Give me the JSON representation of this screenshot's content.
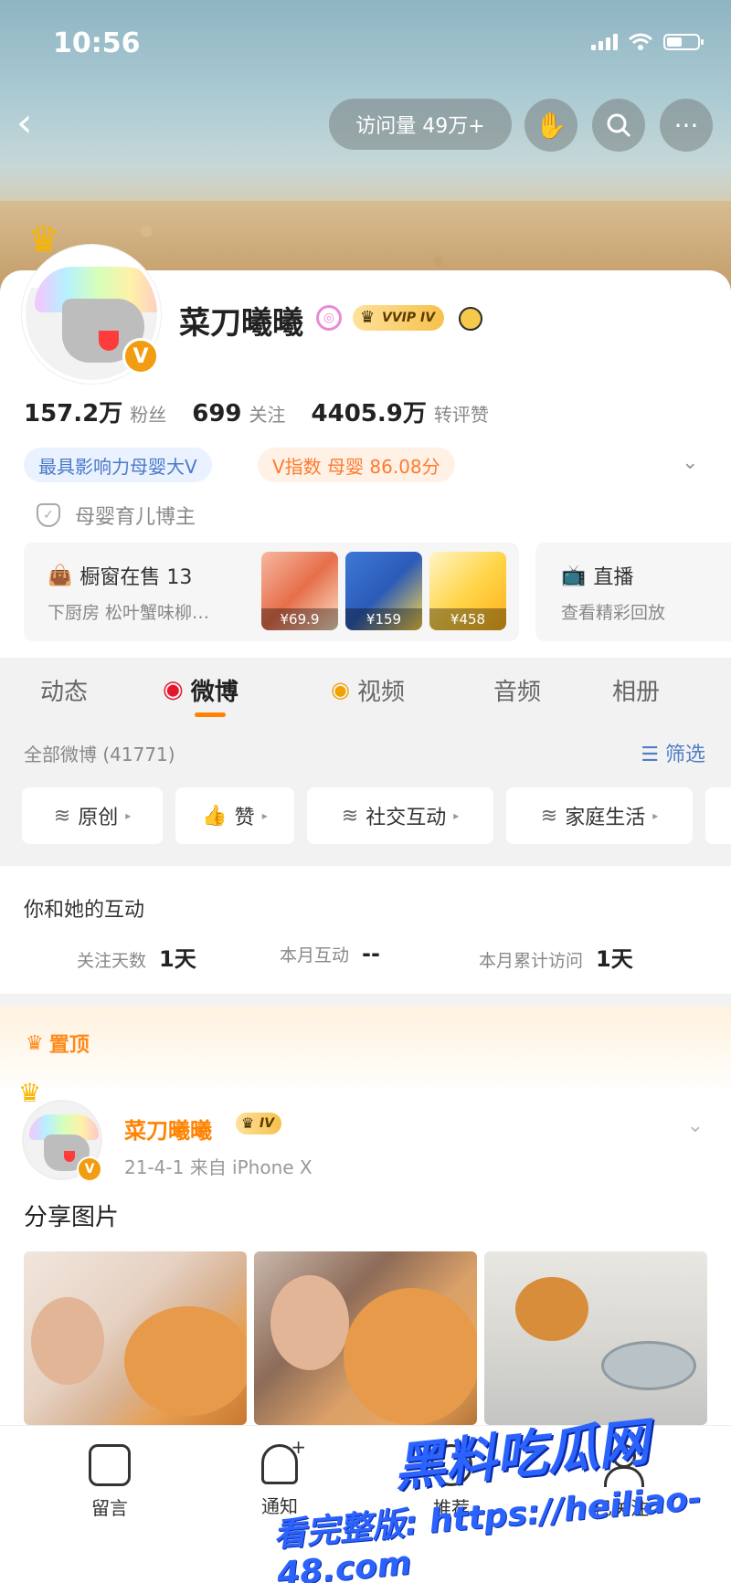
{
  "status_bar": {
    "time": "10:56"
  },
  "header": {
    "back_icon": "chevron-left-icon",
    "visits_label": "访问量 49万+",
    "icons": [
      "hand-icon",
      "search-icon",
      "more-icon"
    ]
  },
  "profile": {
    "name": "菜刀曦曦",
    "vvip_label": "VVIP IV",
    "v_badge": "V",
    "stats": [
      {
        "num": "157.2万",
        "label": "粉丝"
      },
      {
        "num": "699",
        "label": "关注"
      },
      {
        "num": "4405.9万",
        "label": "转评赞"
      }
    ],
    "tags": {
      "influence": "最具影响力母婴大V",
      "v_index": "V指数 母婴 86.08分"
    },
    "certification": "母婴育儿博主"
  },
  "shop": {
    "title": "橱窗在售 13",
    "subtitle": "下厨房 松叶蟹味柳…",
    "prices": [
      "¥69.9",
      "¥159",
      "¥458"
    ]
  },
  "live": {
    "title": "直播",
    "subtitle": "查看精彩回放"
  },
  "tabs": [
    {
      "label": "动态",
      "active": false
    },
    {
      "label": "微博",
      "active": true
    },
    {
      "label": "视频",
      "active": false
    },
    {
      "label": "音频",
      "active": false
    },
    {
      "label": "相册",
      "active": false
    }
  ],
  "feed_filter": {
    "all_label": "全部微博 (41771)",
    "filter_label": "筛选",
    "chips": [
      "原创",
      "赞",
      "社交互动",
      "家庭生活"
    ]
  },
  "interaction": {
    "title": "你和她的互动",
    "items": [
      {
        "label": "关注天数",
        "value": "1天"
      },
      {
        "label": "本月互动",
        "value": "--"
      },
      {
        "label": "本月累计访问",
        "value": "1天"
      }
    ]
  },
  "pinned": {
    "label": "置顶"
  },
  "post": {
    "name": "菜刀曦曦",
    "level": "IV",
    "meta": "21-4-1 来自 iPhone X",
    "text": "分享图片"
  },
  "bottom_nav": [
    {
      "label": "留言",
      "icon": "message-icon"
    },
    {
      "label": "通知",
      "icon": "bell-plus-icon"
    },
    {
      "label": "推荐",
      "icon": "recommend-icon"
    },
    {
      "label": "已关注",
      "icon": "person-icon"
    }
  ],
  "watermark": {
    "line1": "黑料吃瓜网",
    "line2": "看完整版: https://heiliao-48.com"
  },
  "colors": {
    "accent": "#ff8200",
    "link": "#4f7fc4",
    "watermark": "#2b63ff"
  }
}
